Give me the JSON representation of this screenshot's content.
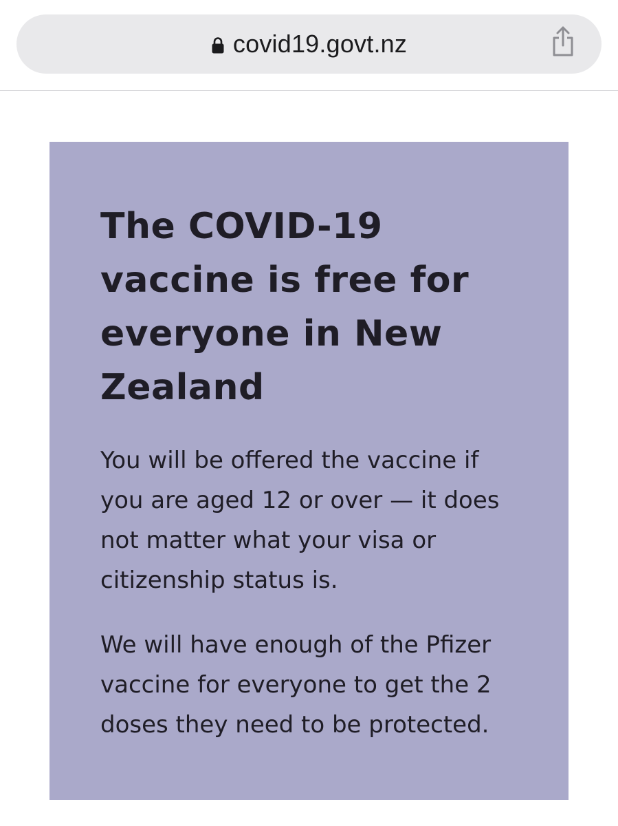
{
  "browser": {
    "url": "covid19.govt.nz",
    "icons": {
      "lock": "lock-icon",
      "share": "share-icon"
    }
  },
  "card": {
    "background": "#aaa9ca",
    "heading": "The COVID-19 vaccine is free for everyone in New Zealand",
    "paragraphs": [
      "You will be offered the vaccine if you are aged 12 or over — it does not matter what your visa or citizenship status is.",
      "We will have enough of the Pfizer vaccine for everyone to get the 2 doses they need to be protected."
    ]
  }
}
